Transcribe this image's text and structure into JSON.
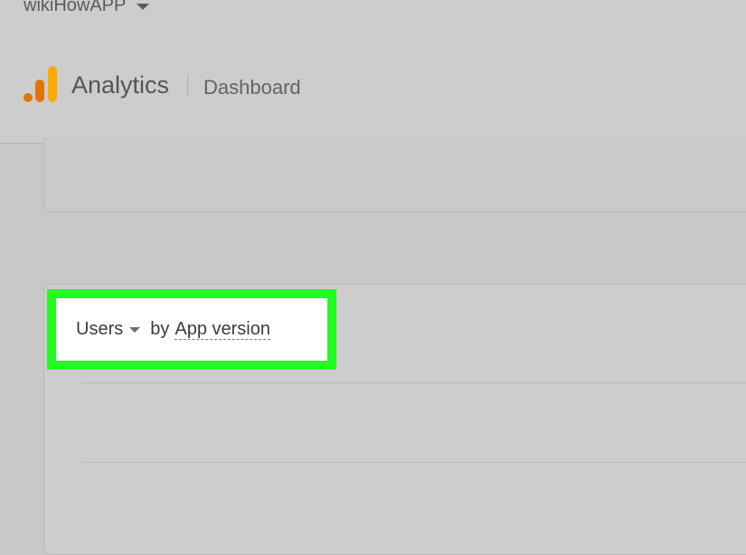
{
  "header": {
    "account_name": "wikiHowAPP",
    "app_name": "Analytics",
    "page_name": "Dashboard"
  },
  "icons": {
    "account_caret": "caret-down-icon",
    "logo": "analytics-logo",
    "metric_caret": "caret-down-icon"
  },
  "colors": {
    "logo_orange": "#e37400",
    "logo_yellow": "#f9ab00",
    "highlight_green": "#23fb23"
  },
  "report_card": {
    "metric_label": "Users",
    "connector": "by",
    "dimension_label": "App version"
  }
}
